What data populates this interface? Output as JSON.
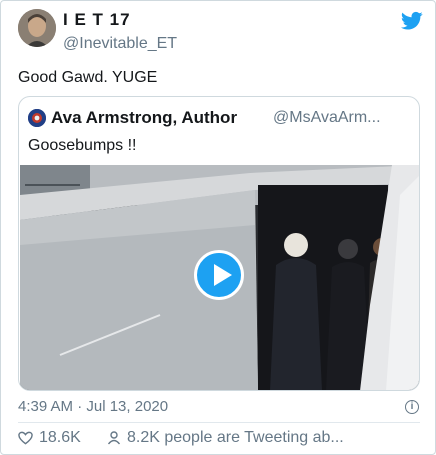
{
  "tweet": {
    "author_name": "I E T 17",
    "author_handle": "@Inevitable_ET",
    "text": "Good Gawd.  YUGE",
    "timestamp": "4:39 AM · Jul 13, 2020",
    "likes": "18.6K",
    "retweets_text": "8.2K people are Tweeting ab...",
    "brand_color": "#1da1f2",
    "icons": [
      "twitter-bird-icon",
      "info-icon",
      "heart-icon",
      "people-icon",
      "play-icon"
    ]
  },
  "quoted_tweet": {
    "author_name": "Ava Armstrong, Author",
    "author_handle": "@MsAvaArm...",
    "text": "Goosebumps !!",
    "media_type": "video"
  }
}
